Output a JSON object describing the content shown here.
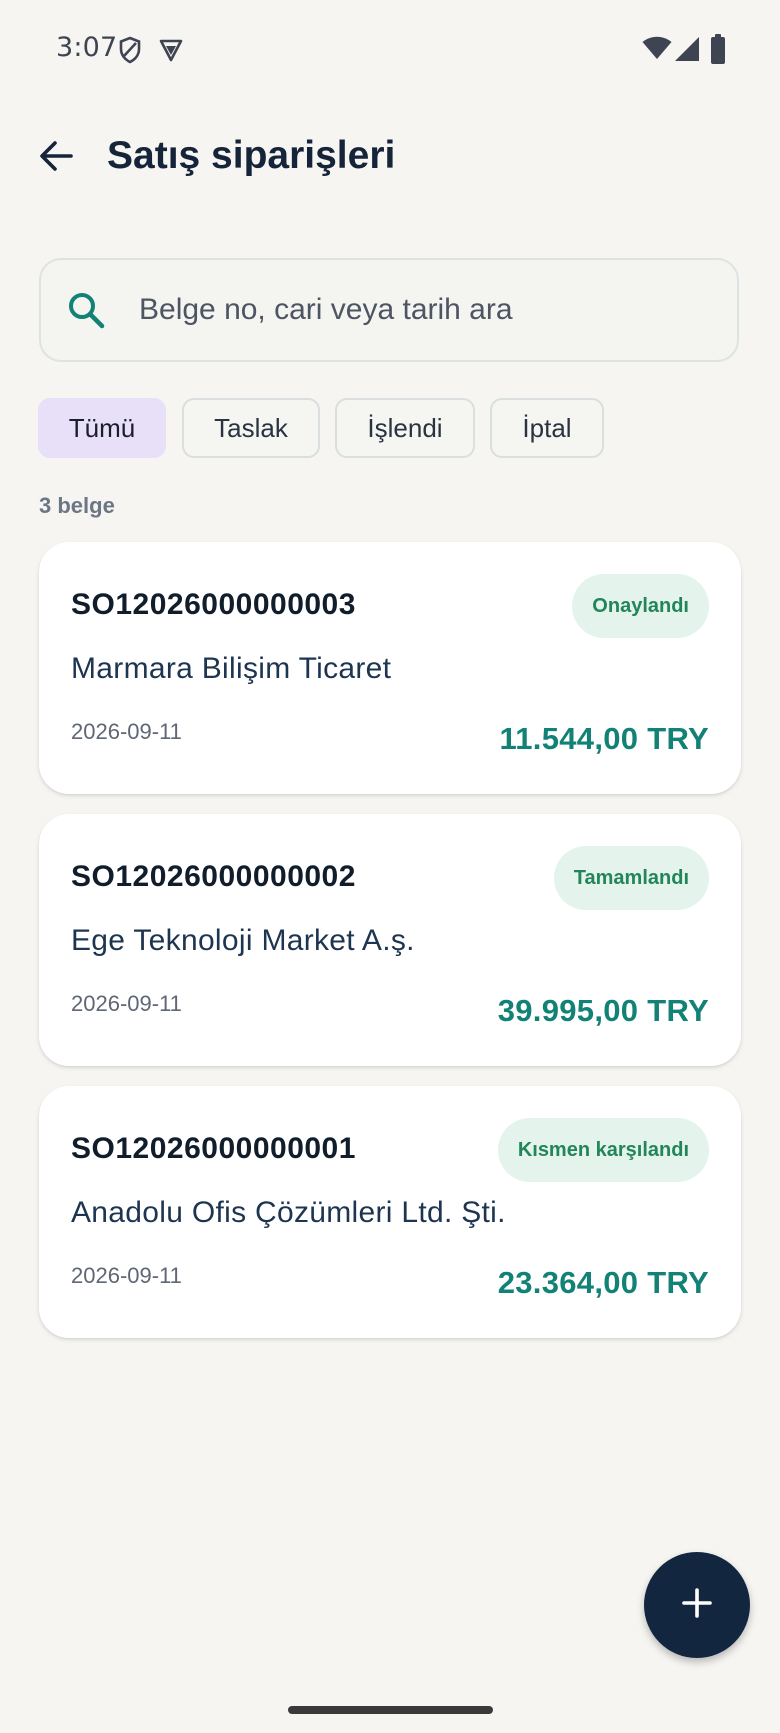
{
  "status_bar": {
    "time": "3:07",
    "left_icons": [
      "shield-icon",
      "vpn-badge-icon"
    ],
    "right_icons": [
      "wifi-icon",
      "cellular-signal-icon",
      "battery-icon"
    ]
  },
  "app_bar": {
    "title": "Satış siparişleri",
    "back_icon": "arrow-back-icon"
  },
  "search": {
    "placeholder": "Belge no, cari veya tarih ara",
    "value": "",
    "icon": "search-icon",
    "accent_color": "#118275"
  },
  "filters": {
    "chips": [
      {
        "label": "Tümü",
        "selected": true
      },
      {
        "label": "Taslak",
        "selected": false
      },
      {
        "label": "İşlendi",
        "selected": false
      },
      {
        "label": "İptal",
        "selected": false
      }
    ],
    "selected_color": "#e7e0f8"
  },
  "list": {
    "count_label": "3 belge",
    "orders": [
      {
        "doc_no": "SO12026000000003",
        "status": "Onaylandı",
        "customer": "Marmara Bilişim Ticaret",
        "date": "2026-09-11",
        "amount": "11.544,00 TRY"
      },
      {
        "doc_no": "SO12026000000002",
        "status": "Tamamlandı",
        "customer": "Ege Teknoloji Market A.ş.",
        "date": "2026-09-11",
        "amount": "39.995,00 TRY"
      },
      {
        "doc_no": "SO12026000000001",
        "status": "Kısmen karşılandı",
        "customer": "Anadolu Ofis Çözümleri Ltd. Şti.",
        "date": "2026-09-11",
        "amount": "23.364,00 TRY"
      }
    ],
    "status_badge_bg": "#e4f3ec",
    "status_badge_color": "#23855a",
    "amount_color": "#118275"
  },
  "fab": {
    "icon": "plus-icon",
    "color": "#13263f"
  }
}
